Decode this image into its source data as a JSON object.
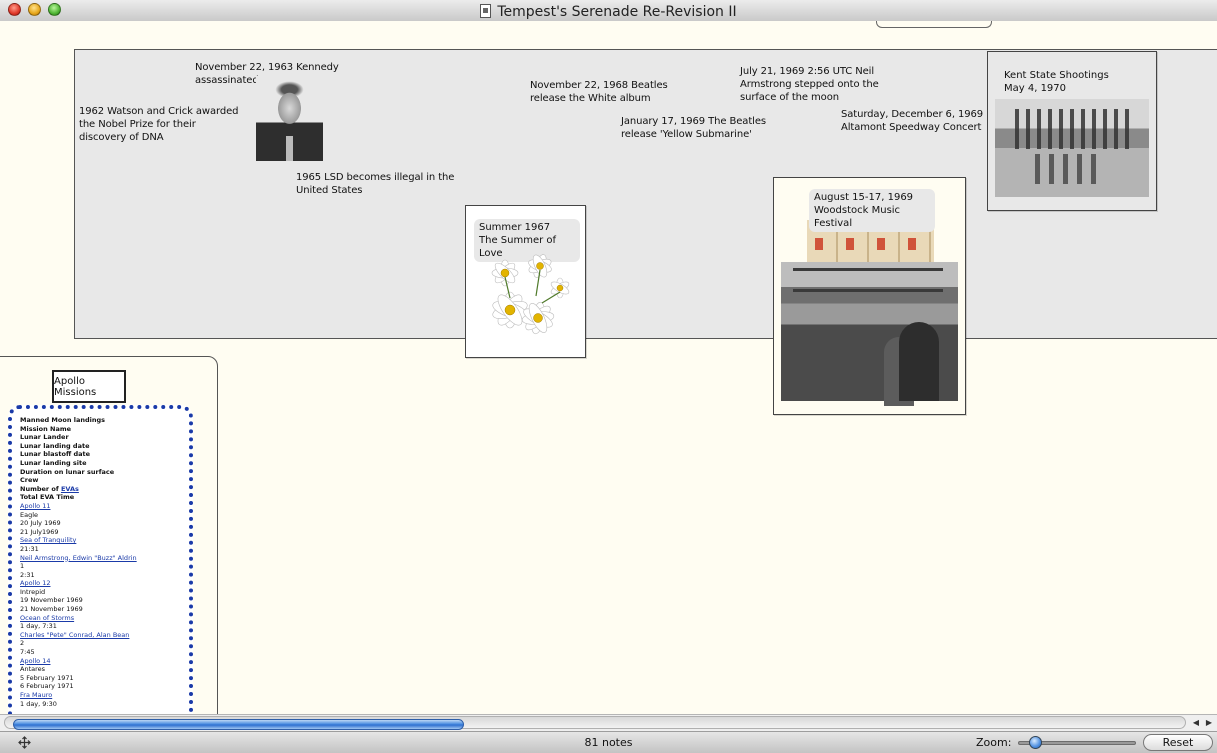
{
  "window": {
    "title": "Tempest's Serenade Re-Revision II"
  },
  "timeline": {
    "notes": {
      "watson_crick": "1962 Watson and Crick awarded\nthe Nobel Prize for their\ndiscovery of DNA",
      "kennedy": "November 22, 1963 Kennedy\nassassinated",
      "lsd": "1965 LSD becomes illegal in the\nUnited States",
      "beatles_white": "November 22, 1968 Beatles\nrelease the White album",
      "beatles_yellow": "January 17, 1969 The Beatles\nrelease 'Yellow Submarine'",
      "armstrong": "July 21, 1969 2:56 UTC Neil\nArmstrong stepped onto the\nsurface of the moon",
      "altamont": "Saturday, December 6, 1969\nAltamont Speedway Concert"
    },
    "cards": {
      "summer": "Summer 1967\nThe Summer of Love",
      "woodstock": "August 15-17, 1969\nWoodstock Music Festival",
      "kent_state": "Kent State Shootings\nMay 4, 1970"
    }
  },
  "apollo": {
    "title": "Apollo Missions",
    "headers": [
      "Manned Moon landings",
      "Mission Name",
      "Lunar Lander",
      "Lunar landing date",
      "Lunar blastoff date",
      "Lunar landing site",
      "Duration on lunar surface",
      "Crew"
    ],
    "evas_prefix": "Number of ",
    "evas_link": "EVAs",
    "total_eva": "Total EVA Time",
    "rows": [
      {
        "text": "Apollo 11",
        "link": true
      },
      {
        "text": "Eagle",
        "link": false
      },
      {
        "text": "20 July 1969",
        "link": false
      },
      {
        "text": "21 July1969",
        "link": false
      },
      {
        "text": "Sea of Tranquility",
        "link": true
      },
      {
        "text": "21:31",
        "link": false
      },
      {
        "text": "Neil Armstrong, Edwin \"Buzz\" Aldrin",
        "link": true
      },
      {
        "text": "1",
        "link": false
      },
      {
        "text": "2:31",
        "link": false
      },
      {
        "text": "Apollo 12",
        "link": true
      },
      {
        "text": "Intrepid",
        "link": false
      },
      {
        "text": "19 November 1969",
        "link": false
      },
      {
        "text": "21 November 1969",
        "link": false
      },
      {
        "text": "Ocean of Storms",
        "link": true
      },
      {
        "text": "1 day, 7:31",
        "link": false
      },
      {
        "text": "Charles \"Pete\" Conrad, Alan Bean",
        "link": true
      },
      {
        "text": "2",
        "link": false
      },
      {
        "text": "7:45",
        "link": false
      },
      {
        "text": "Apollo 14",
        "link": true
      },
      {
        "text": "Antares",
        "link": false
      },
      {
        "text": "5 February 1971",
        "link": false
      },
      {
        "text": "6 February 1971",
        "link": false
      },
      {
        "text": "Fra Mauro",
        "link": true
      },
      {
        "text": "1 day, 9:30",
        "link": false
      }
    ]
  },
  "statusbar": {
    "notes_count": "81 notes",
    "zoom_label": "Zoom:",
    "zoom_level": 0.1,
    "reset_label": "Reset"
  },
  "icons": {
    "move": "move-icon",
    "scroll_left": "arrow-left-icon",
    "scroll_right": "arrow-right-icon"
  },
  "colors": {
    "canvas": "#fffdf2",
    "timeline_bg": "#e8e8e8",
    "link": "#1a3aa8",
    "scroll_thumb": "#2d6fcf"
  }
}
